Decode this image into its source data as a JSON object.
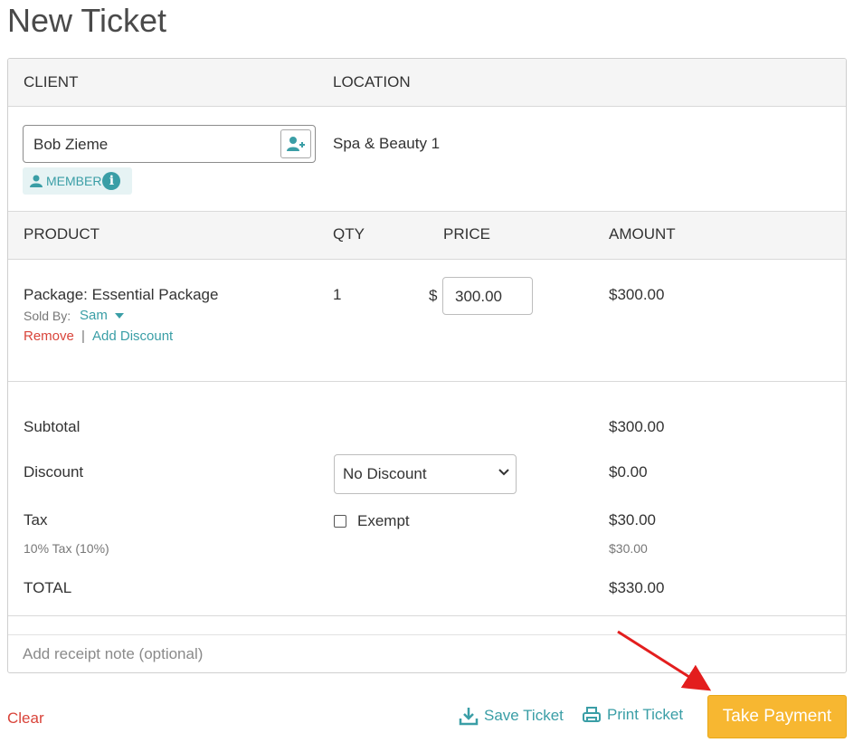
{
  "page": {
    "title": "New Ticket"
  },
  "client_section": {
    "client_header": "CLIENT",
    "location_header": "LOCATION",
    "client_name": "Bob Zieme",
    "member_badge": "MEMBER",
    "location": "Spa & Beauty 1"
  },
  "items_section": {
    "headers": {
      "product": "PRODUCT",
      "qty": "QTY",
      "price": "PRICE",
      "amount": "AMOUNT"
    },
    "items": [
      {
        "product": "Package: Essential Package",
        "sold_by_label": "Sold By:",
        "sold_by": "Sam",
        "remove": "Remove",
        "separator": "|",
        "add_discount": "Add Discount",
        "qty": "1",
        "currency": "$",
        "price": "300.00",
        "amount": "$300.00"
      }
    ]
  },
  "totals": {
    "subtotal_label": "Subtotal",
    "subtotal": "$300.00",
    "discount_label": "Discount",
    "discount_option": "No Discount",
    "discount": "$0.00",
    "tax_label": "Tax",
    "tax_detail": "10% Tax (10%)",
    "exempt_label": "Exempt",
    "tax": "$30.00",
    "tax_detail_amount": "$30.00",
    "total_label": "TOTAL",
    "total": "$330.00"
  },
  "receipt_note": {
    "placeholder": "Add receipt note (optional)"
  },
  "footer": {
    "clear": "Clear",
    "save_ticket": "Save Ticket",
    "print_ticket": "Print Ticket",
    "take_payment": "Take Payment"
  },
  "colors": {
    "accent": "#3a9ea6",
    "danger": "#d9443a",
    "primary_button": "#f7b731",
    "annotation_arrow": "#e31e1e"
  }
}
